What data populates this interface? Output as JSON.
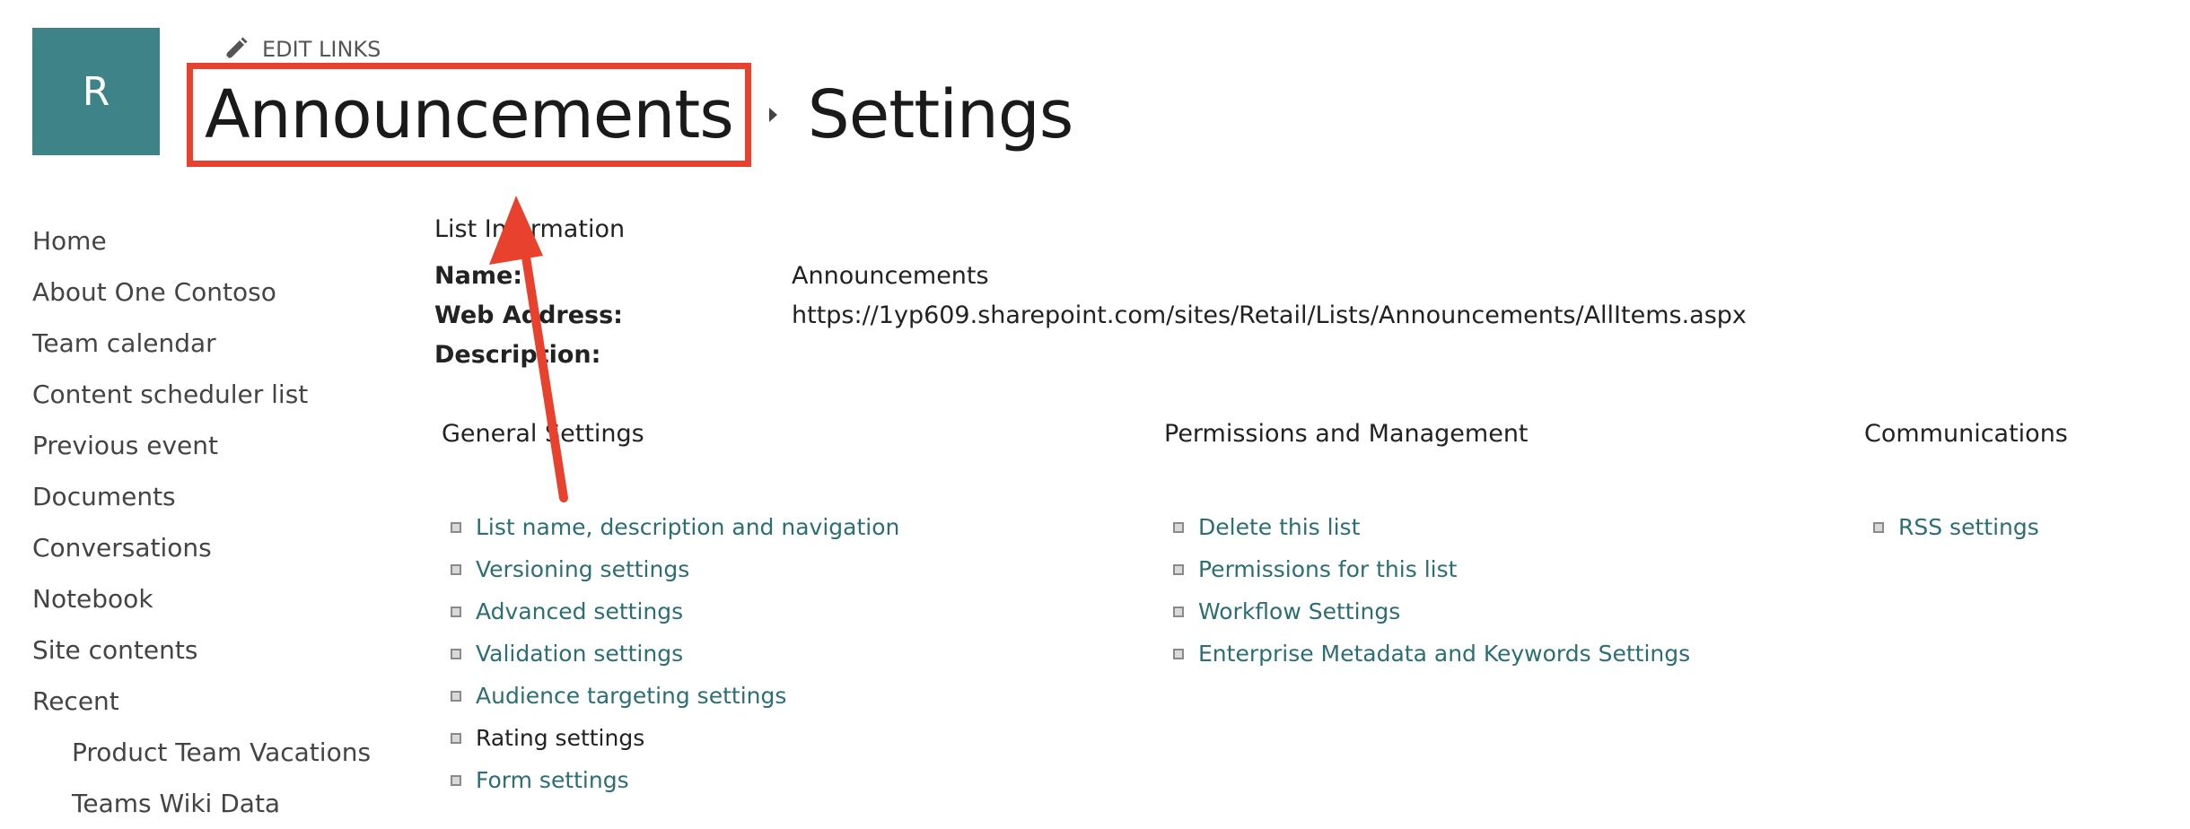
{
  "header": {
    "site_logo_letter": "R",
    "edit_links_label": "EDIT LINKS",
    "breadcrumb": {
      "list_name": "Announcements",
      "current": "Settings"
    }
  },
  "quick_launch": {
    "items": [
      {
        "label": "Home"
      },
      {
        "label": "About One Contoso"
      },
      {
        "label": "Team calendar"
      },
      {
        "label": "Content scheduler list"
      },
      {
        "label": "Previous event"
      },
      {
        "label": "Documents"
      },
      {
        "label": "Conversations"
      },
      {
        "label": "Notebook"
      },
      {
        "label": "Site contents"
      },
      {
        "label": "Recent"
      }
    ],
    "recent_items": [
      {
        "label": "Product Team Vacations"
      },
      {
        "label": "Teams Wiki Data"
      }
    ]
  },
  "list_information": {
    "title": "List Information",
    "name_label": "Name:",
    "name_value": "Announcements",
    "web_address_label": "Web Address:",
    "web_address_value": "https://1yp609.sharepoint.com/sites/Retail/Lists/Announcements/AllItems.aspx",
    "description_label": "Description:",
    "description_value": ""
  },
  "sections": {
    "general": {
      "title": "General Settings",
      "links": [
        {
          "label": "List name, description and navigation"
        },
        {
          "label": "Versioning settings"
        },
        {
          "label": "Advanced settings"
        },
        {
          "label": "Validation settings"
        },
        {
          "label": "Audience targeting settings"
        },
        {
          "label": "Rating settings"
        },
        {
          "label": "Form settings"
        }
      ]
    },
    "permissions": {
      "title": "Permissions and Management",
      "links": [
        {
          "label": "Delete this list"
        },
        {
          "label": "Permissions for this list"
        },
        {
          "label": "Workflow Settings"
        },
        {
          "label": "Enterprise Metadata and Keywords Settings"
        }
      ]
    },
    "communications": {
      "title": "Communications",
      "links": [
        {
          "label": "RSS settings"
        }
      ]
    }
  },
  "colors": {
    "logo_bg": "#3E8388",
    "link": "#2B6F73",
    "annotation": "#E8422F"
  },
  "icons": {
    "edit": "pencil-icon",
    "breadcrumb_separator": "caret-right-icon",
    "link_bullet": "square-bullet-icon"
  }
}
